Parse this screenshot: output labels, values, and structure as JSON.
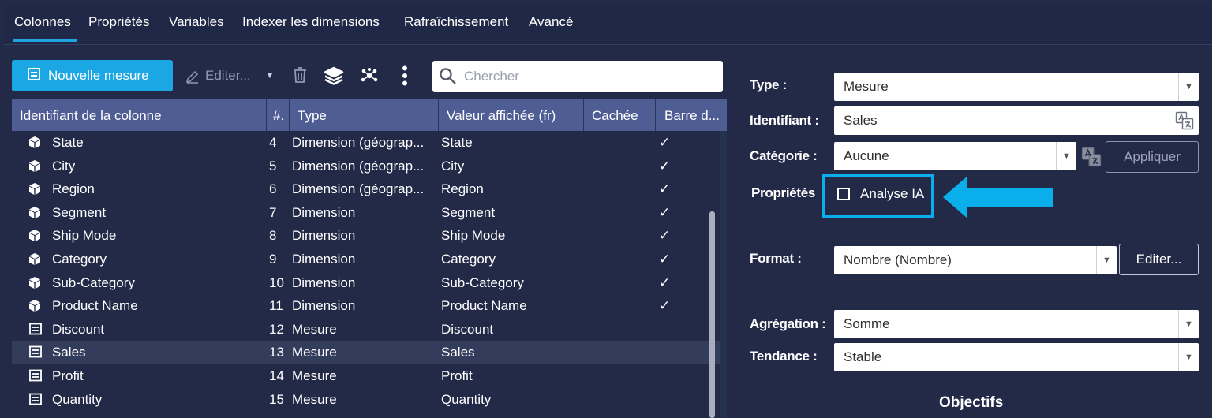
{
  "tabs": [
    {
      "label": "Colonnes",
      "active": true
    },
    {
      "label": "Propriétés",
      "active": false
    },
    {
      "label": "Variables",
      "active": false
    },
    {
      "label": "Indexer les dimensions",
      "active": false
    },
    {
      "label": "Rafraîchissement",
      "active": false
    },
    {
      "label": "Avancé",
      "active": false
    }
  ],
  "toolbar": {
    "new_measure_label": "Nouvelle mesure",
    "edit_label": "Editer...",
    "search_placeholder": "Chercher",
    "icons": [
      "new-measure-icon",
      "pencil-icon",
      "caret-down-icon",
      "trash-icon",
      "layers-icon",
      "network-icon",
      "more-vertical-icon",
      "search-icon"
    ]
  },
  "table": {
    "columns": [
      "Identifiant de la colonne",
      "#.",
      "Type",
      "Valeur affichée (fr)",
      "Cachée",
      "Barre d..."
    ],
    "rows": [
      {
        "icon": "cube-icon",
        "id": "State",
        "num": "4",
        "type": "Dimension (géograp...",
        "display": "State",
        "cachee": "",
        "barre": "✓",
        "selected": false
      },
      {
        "icon": "cube-icon",
        "id": "City",
        "num": "5",
        "type": "Dimension (géograp...",
        "display": "City",
        "cachee": "",
        "barre": "✓",
        "selected": false
      },
      {
        "icon": "cube-icon",
        "id": "Region",
        "num": "6",
        "type": "Dimension (géograp...",
        "display": "Region",
        "cachee": "",
        "barre": "✓",
        "selected": false
      },
      {
        "icon": "cube-icon",
        "id": "Segment",
        "num": "7",
        "type": "Dimension",
        "display": "Segment",
        "cachee": "",
        "barre": "✓",
        "selected": false
      },
      {
        "icon": "cube-icon",
        "id": "Ship Mode",
        "num": "8",
        "type": "Dimension",
        "display": "Ship Mode",
        "cachee": "",
        "barre": "✓",
        "selected": false
      },
      {
        "icon": "cube-icon",
        "id": "Category",
        "num": "9",
        "type": "Dimension",
        "display": "Category",
        "cachee": "",
        "barre": "✓",
        "selected": false
      },
      {
        "icon": "cube-icon",
        "id": "Sub-Category",
        "num": "10",
        "type": "Dimension",
        "display": "Sub-Category",
        "cachee": "",
        "barre": "✓",
        "selected": false
      },
      {
        "icon": "cube-icon",
        "id": "Product Name",
        "num": "11",
        "type": "Dimension",
        "display": "Product Name",
        "cachee": "",
        "barre": "✓",
        "selected": false
      },
      {
        "icon": "measure-icon",
        "id": "Discount",
        "num": "12",
        "type": "Mesure",
        "display": "Discount",
        "cachee": "",
        "barre": "",
        "selected": false
      },
      {
        "icon": "measure-icon",
        "id": "Sales",
        "num": "13",
        "type": "Mesure",
        "display": "Sales",
        "cachee": "",
        "barre": "",
        "selected": true
      },
      {
        "icon": "measure-icon",
        "id": "Profit",
        "num": "14",
        "type": "Mesure",
        "display": "Profit",
        "cachee": "",
        "barre": "",
        "selected": false
      },
      {
        "icon": "measure-icon",
        "id": "Quantity",
        "num": "15",
        "type": "Mesure",
        "display": "Quantity",
        "cachee": "",
        "barre": "",
        "selected": false
      }
    ]
  },
  "form": {
    "type": {
      "label": "Type :",
      "value": "Mesure"
    },
    "identifiant": {
      "label": "Identifiant :",
      "value": "Sales"
    },
    "categorie": {
      "label": "Catégorie :",
      "value": "Aucune",
      "apply_label": "Appliquer"
    },
    "proprietes": {
      "label": "Propriétés",
      "checkbox_label": "Analyse IA",
      "checked": false
    },
    "format": {
      "label": "Format :",
      "value": "Nombre (Nombre)",
      "edit_label": "Editer..."
    },
    "aggregation": {
      "label": "Agrégation :",
      "value": "Somme"
    },
    "tendance": {
      "label": "Tendance :",
      "value": "Stable"
    },
    "objectifs_title": "Objectifs"
  },
  "colors": {
    "background": "#222a48",
    "accent": "#1ba7e3",
    "table_header": "#4f5d95",
    "selected_row": "#343c5b",
    "highlight": "#0aaeea"
  }
}
